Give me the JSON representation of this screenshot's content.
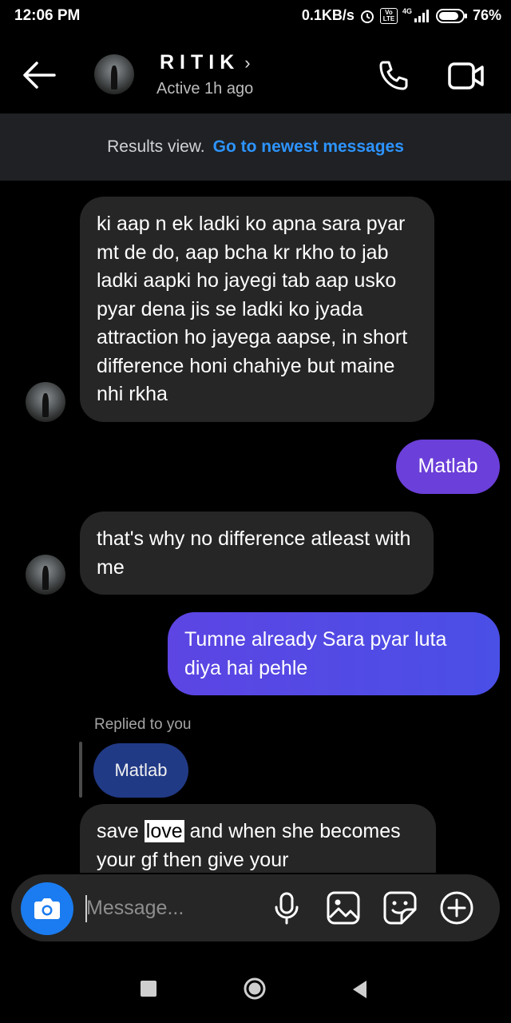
{
  "status_bar": {
    "time": "12:06 PM",
    "net_speed": "0.1KB/s",
    "battery": "76%",
    "network": "4G",
    "volte": "Vo LTE"
  },
  "header": {
    "contact_name": "RITIK",
    "chevron": "›",
    "active_status": "Active 1h ago"
  },
  "banner": {
    "text": "Results view.",
    "link": "Go to newest messages"
  },
  "messages": [
    {
      "from": "them",
      "text": "ki aap n ek ladki ko apna sara pyar mt de do, aap bcha kr rkho to jab ladki aapki ho jayegi tab aap usko pyar dena jis se ladki ko jyada attraction ho jayega aapse, in short difference honi chahiye but maine nhi rkha"
    },
    {
      "from": "me",
      "text": "Matlab"
    },
    {
      "from": "them",
      "text": "that's why no difference atleast with me"
    },
    {
      "from": "me",
      "text": "Tumne already Sara pyar luta diya hai pehle"
    },
    {
      "from": "them",
      "replied_label": "Replied to you",
      "reply_quote": "Matlab",
      "text_before": "save ",
      "highlight": "love",
      "text_after": " and when she becomes your gf then give your"
    }
  ],
  "composer": {
    "placeholder": "Message..."
  },
  "colors": {
    "incoming_bubble": "#262626",
    "outgoing_purple": "#6b3fd9",
    "outgoing_blue": "#4a4fe6",
    "reply_quote": "#213a86",
    "link": "#2d94ff",
    "camera_button": "#1a7cf0"
  },
  "icons": [
    "back-arrow-icon",
    "phone-icon",
    "video-call-icon",
    "camera-icon",
    "microphone-icon",
    "gallery-icon",
    "sticker-icon",
    "plus-circle-icon"
  ]
}
